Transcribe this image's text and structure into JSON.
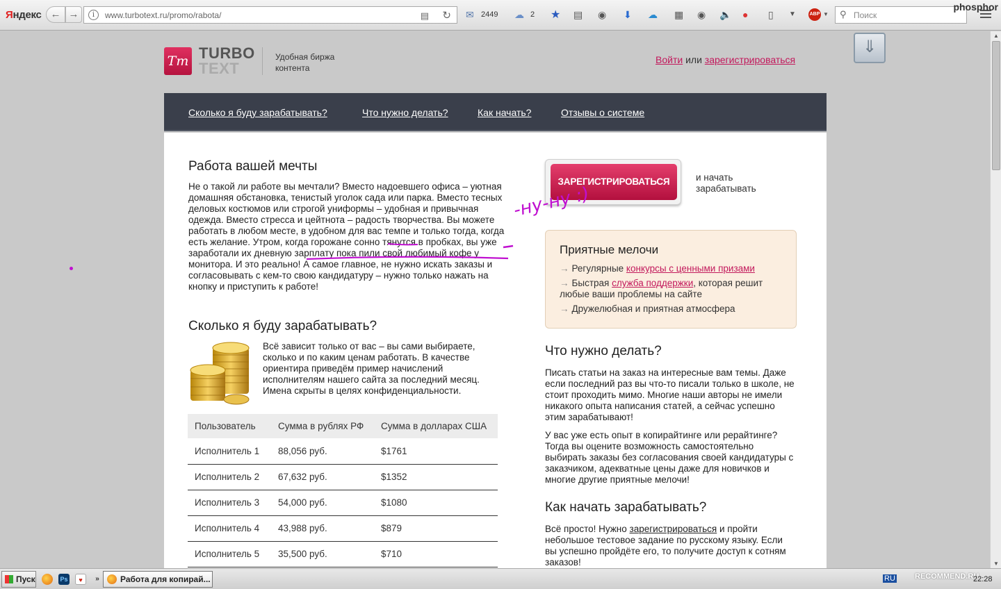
{
  "browser": {
    "yandex_brand_first": "Я",
    "yandex_brand_rest": "ндекс",
    "url": "www.turbotext.ru/promo/rabota/",
    "mail_count": "2449",
    "cloud_count": "2",
    "search_placeholder": "Поиск",
    "username": "phosphor"
  },
  "header": {
    "logo_letters": "Tт",
    "logo_line1": "TURBO",
    "logo_line2": "TEXT",
    "tagline": "Удобная биржа контента",
    "login_link": "Войти",
    "or_text": "или",
    "register_link": "зарегистрироваться"
  },
  "nav": [
    "Сколько я буду зарабатывать?",
    "Что нужно делать?",
    "Как начать?",
    "Отзывы о системе"
  ],
  "left": {
    "dream_title": "Работа вашей мечты",
    "dream_text_a": "Не о такой ли работе вы мечтали? Вместо надоевшего офиса – уютная домашняя обстановка, тенистый уголок сада или парка. Вместо тесных деловых костюмов или строгой униформы – удобная и привычная одежда. Вместо стресса и цейтнота – радость творчества. Вы можете работать в любом месте, в удобном для вас темпе и только тогда, когда есть желание. ",
    "dream_text_b": "Утром",
    "dream_text_c": ", когда горожане сонно тянутся в пробках, ",
    "dream_text_d": "вы уже заработали их дневную зарплату",
    "dream_text_e": " пока пили свой любимый кофе у монитора. И это реально! А самое главное, не нужно искать заказы и согласовывать с кем-то свою кандидатуру – нужно только нажать на кнопку и приступить к работе!",
    "earn_title": "Сколько я буду зарабатывать?",
    "earn_text": "Всё зависит только от вас – вы сами выбираете, сколько и по каким ценам работать. В качестве ориентира приведём пример начислений исполнителям нашего сайта за последний месяц. Имена скрыты в целях конфиденциальности.",
    "table_headers": [
      "Пользователь",
      "Сумма в рублях РФ",
      "Сумма в долларах США"
    ],
    "table_rows": [
      [
        "Исполнитель 1",
        "88,056 руб.",
        "$1761"
      ],
      [
        "Исполнитель 2",
        "67,632 руб.",
        "$1352"
      ],
      [
        "Исполнитель 3",
        "54,000 руб.",
        "$1080"
      ],
      [
        "Исполнитель 4",
        "43,988 руб.",
        "$879"
      ],
      [
        "Исполнитель 5",
        "35,500 руб.",
        "$710"
      ]
    ]
  },
  "right": {
    "register_button": "ЗАРЕГИСТРИРОВАТЬСЯ",
    "register_note": "и начать зарабатывать",
    "annotation": "-ну-ну :)",
    "perks_title": "Приятные мелочи",
    "perk1_text": "Регулярные ",
    "perk1_link": "конкурсы с ценными призами",
    "perk2_text": "Быстрая ",
    "perk2_link": "служба поддержки",
    "perk2_rest": ", которая решит любые ваши проблемы на сайте",
    "perk3_text": "Дружелюбная и приятная атмосфера",
    "todo_title": "Что нужно делать?",
    "todo_text1": "Писать статьи на заказ на интересные вам темы. Даже если последний раз вы что-то писали только в школе, не стоит проходить мимо. Многие наши авторы не имели никакого опыта написания статей, а сейчас успешно этим зарабатывают!",
    "todo_text2": "У вас уже есть опыт в копирайтинге или рерайтинге? Тогда вы оцените возможность самостоятельно выбирать заказы без согласования своей кандидатуры с заказчиком, адекватные цены даже для новичков и многие другие приятные мелочи!",
    "start_title": "Как начать зарабатывать?",
    "start_text_a": "Всё просто! Нужно ",
    "start_link": "зарегистрироваться",
    "start_text_b": " и пройти небольшое тестовое задание по русскому языку. Если вы успешно пройдёте его, то получите доступ к сотням заказов!"
  },
  "taskbar": {
    "start": "Пуск",
    "task": "Работа для копирай...",
    "lang": "RU",
    "clock": "22:28",
    "watermark": "RECOMMEND.RU"
  },
  "colors": {
    "brand": "#c2185b",
    "annotation": "#c010d0",
    "nav_bg": "#3a3f4b"
  }
}
